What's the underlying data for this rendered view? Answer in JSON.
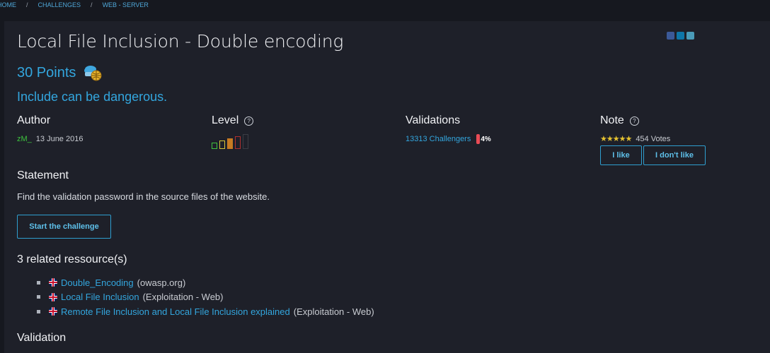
{
  "breadcrumb": {
    "items": [
      "HOME",
      "CHALLENGES",
      "WEB - SERVER"
    ],
    "separator": "/"
  },
  "challenge": {
    "title": "Local File Inclusion - Double encoding",
    "points": "30 Points",
    "tagline": "Include can be dangerous."
  },
  "author": {
    "heading": "Author",
    "name": "zM_",
    "date": "13 June 2016"
  },
  "level": {
    "heading": "Level",
    "help": "?",
    "current": 3,
    "max": 5
  },
  "validations": {
    "heading": "Validations",
    "count": "13313 Challengers",
    "percent": "4%"
  },
  "note": {
    "heading": "Note",
    "help": "?",
    "stars": "★★★★★",
    "votes": "454 Votes",
    "like": "I like",
    "dislike": "I don't like"
  },
  "statement": {
    "heading": "Statement",
    "text": "Find the validation password in the source files of the website.",
    "start_button": "Start the challenge"
  },
  "resources": {
    "heading": "3 related ressource(s)",
    "items": [
      {
        "title": "Double_Encoding",
        "meta": "(owasp.org)"
      },
      {
        "title": "Local File Inclusion",
        "meta": "(Exploitation - Web)"
      },
      {
        "title": "Remote File Inclusion and Local File Inclusion explained",
        "meta": "(Exploitation - Web)"
      }
    ]
  },
  "validation": {
    "heading": "Validation"
  },
  "colors": {
    "accent": "#33a6de",
    "background": "#1e2029",
    "author": "#3ec43e",
    "percent_bar": "#e94b55"
  },
  "social": [
    "facebook-icon",
    "linkedin-icon",
    "share-icon"
  ]
}
